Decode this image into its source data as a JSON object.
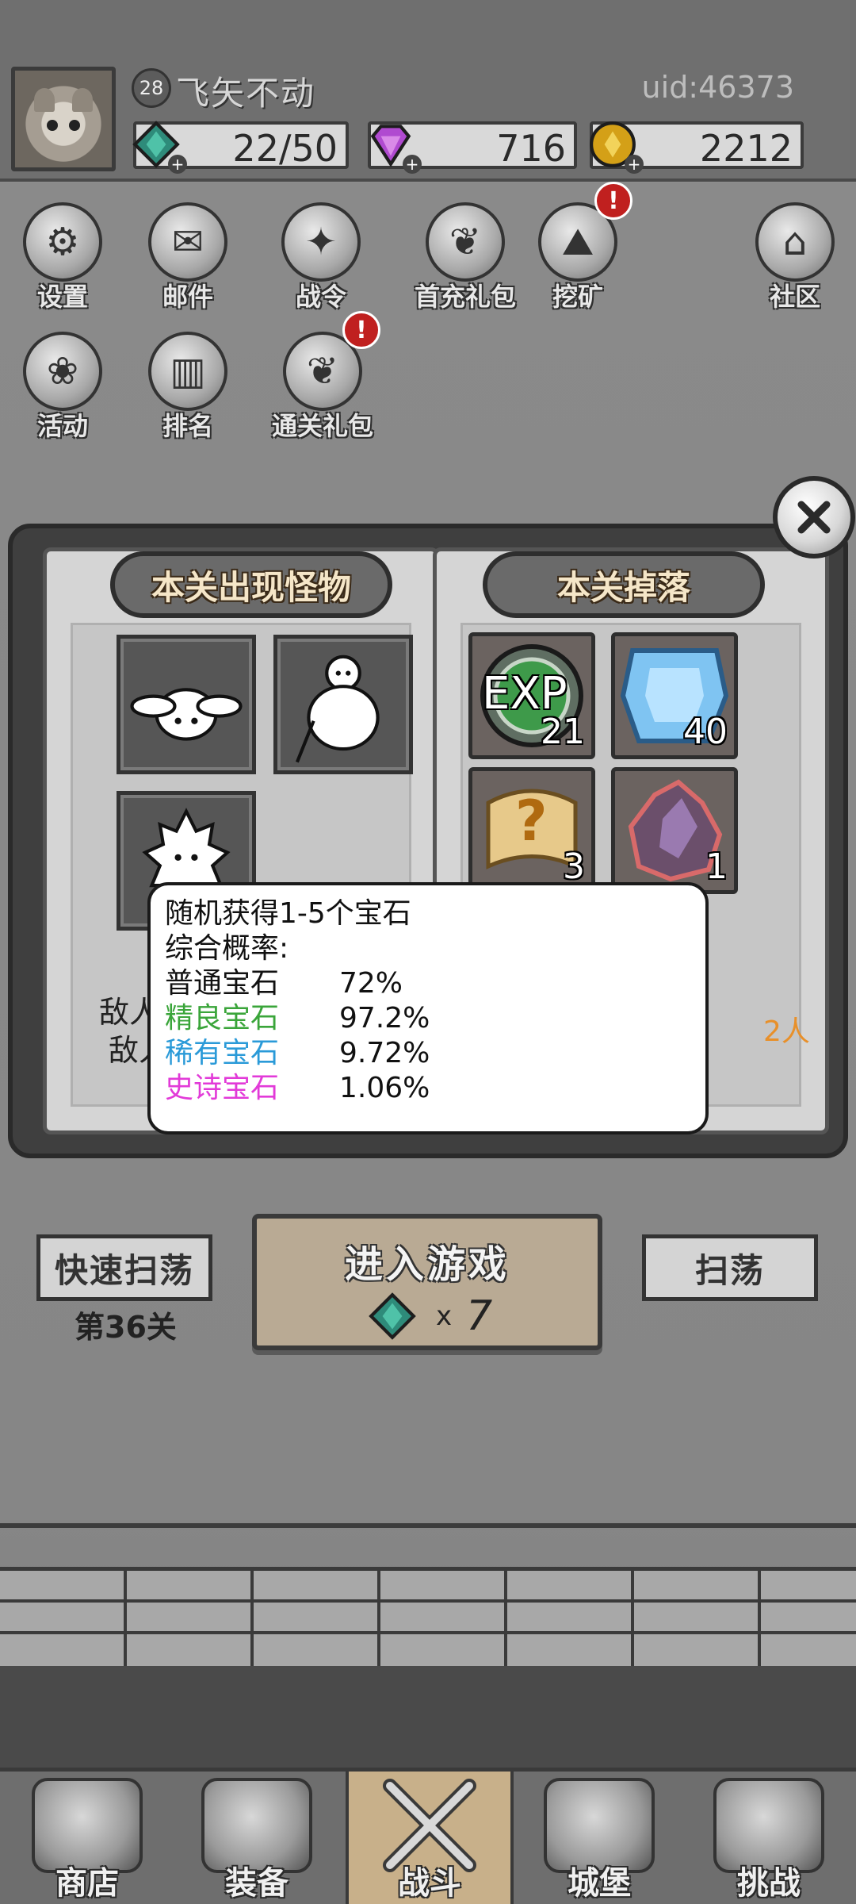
{
  "profile": {
    "level": "28",
    "username": "飞矢不动",
    "uid": "uid:46373"
  },
  "resources": [
    {
      "name": "stamina-gem",
      "value": "22/50",
      "color": "#2e8b7a"
    },
    {
      "name": "diamond",
      "value": "716",
      "color": "#b04ad0"
    },
    {
      "name": "gold-coin",
      "value": "2212",
      "color": "#d4a017"
    }
  ],
  "menu": {
    "settings": "设置",
    "mail": "邮件",
    "battle_pass": "战令",
    "first_recharge": "首充礼包",
    "mining": "挖矿",
    "community": "社区",
    "activity": "活动",
    "ranking": "排名",
    "clear_gift": "通关礼包"
  },
  "notification_mark": "!",
  "dialog": {
    "monsters_title": "本关出现怪物",
    "drops_title": "本关掉落",
    "enemy_text_1": "敌人",
    "enemy_text_2": "敌人",
    "partial_text": "2人",
    "drops": [
      {
        "icon": "exp-icon",
        "label": "EXP",
        "count": "21"
      },
      {
        "icon": "blue-gem-icon",
        "count": "40"
      },
      {
        "icon": "mystery-scroll-icon",
        "label": "?",
        "count": "3"
      },
      {
        "icon": "crystal-ore-icon",
        "count": "1"
      }
    ]
  },
  "tooltip": {
    "line1": "随机获得1-5个宝石",
    "line2": "综合概率:",
    "rows": [
      {
        "name": "普通宝石",
        "pct": "72%",
        "color": "#111111"
      },
      {
        "name": "精良宝石",
        "pct": "97.2%",
        "color": "#3aa53a"
      },
      {
        "name": "稀有宝石",
        "pct": "9.72%",
        "color": "#2a9ad8"
      },
      {
        "name": "史诗宝石",
        "pct": "1.06%",
        "color": "#e23ad8"
      }
    ]
  },
  "actions": {
    "quick_sweep": "快速扫荡",
    "stage": "第36关",
    "enter_game": "进入游戏",
    "cost_x": "x",
    "cost": "7",
    "sweep": "扫荡"
  },
  "bottom_nav": [
    {
      "label": "商店",
      "active": false
    },
    {
      "label": "装备",
      "active": false
    },
    {
      "label": "战斗",
      "active": true
    },
    {
      "label": "城堡",
      "active": false
    },
    {
      "label": "挑战",
      "active": false
    }
  ]
}
